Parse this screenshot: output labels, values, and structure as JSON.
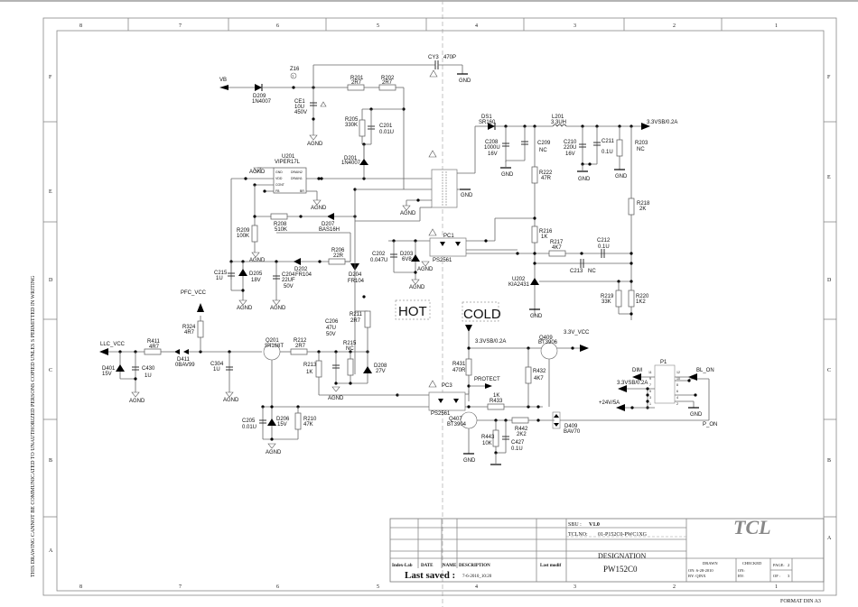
{
  "border": {
    "columns": [
      "8",
      "7",
      "6",
      "5",
      "4",
      "3",
      "2",
      "1"
    ],
    "rows": [
      "F",
      "E",
      "D",
      "C",
      "B",
      "A"
    ],
    "side_notice": "THIS DRAWING CANNOT BE COMMUNICATED TO UNAUTHORIZED PERSONS COPIED UNLES S PERMITTED IN WRITING",
    "format": "FORMAT DIN A3"
  },
  "zones": {
    "hot": "HOT",
    "cold": "COLD"
  },
  "nets": {
    "vb": "VB",
    "v33sb": "3.3VSB/0.2A",
    "v33sb_2": "3.3VSB/0.2A",
    "v33sb_3": "3.3VSB/0.2A",
    "v33_vcc": "3.3V_VCC",
    "pfc_vcc": "PFC_VCC",
    "llc_vcc": "LLC_VCC",
    "protect": "PROTECT",
    "dim": "DIM",
    "bl_on": "BL_ON",
    "v24": "+24V/5A",
    "p_on": "P_ON",
    "gnd": "GND",
    "agnd": "AGND"
  },
  "components": {
    "d209": {
      "ref": "D209",
      "value": "1N4007"
    },
    "z16": {
      "ref": "Z16",
      "value": "T"
    },
    "ce1": {
      "ref": "CE1",
      "value": "10U",
      "value2": "450V"
    },
    "r201": {
      "ref": "R201",
      "value": "2R7"
    },
    "r202": {
      "ref": "R202",
      "value": "2R7"
    },
    "cy3": {
      "ref": "CY3",
      "value": "470P"
    },
    "r205": {
      "ref": "R205",
      "value": "330K"
    },
    "c201": {
      "ref": "C201",
      "value": "0.01U"
    },
    "ds1": {
      "ref": "DS1",
      "value": "SR160"
    },
    "l201": {
      "ref": "L201",
      "value": "3.3UH"
    },
    "c208": {
      "ref": "C208",
      "value": "1000U",
      "value2": "16V"
    },
    "c209": {
      "ref": "C209",
      "value": "NC"
    },
    "c210": {
      "ref": "C210",
      "value": "220U",
      "value2": "16V"
    },
    "c211": {
      "ref": "C211",
      "value": "0.1U"
    },
    "r203": {
      "ref": "R203",
      "value": "NC"
    },
    "r222": {
      "ref": "R222",
      "value": "47R"
    },
    "r218": {
      "ref": "R218",
      "value": "2K"
    },
    "u201": {
      "ref": "U201",
      "value": "VIPER17L",
      "pins": [
        "GND",
        "VDD",
        "CONT",
        "FB",
        "DRAIN2",
        "DRAIN1",
        "BR"
      ]
    },
    "d201": {
      "ref": "D201",
      "value": "1N4007"
    },
    "r208": {
      "ref": "R208",
      "value": "510K"
    },
    "d207": {
      "ref": "D207",
      "value": "BAS16H"
    },
    "r209": {
      "ref": "R209",
      "value": "100K"
    },
    "r206": {
      "ref": "R206",
      "value": "22R"
    },
    "d202": {
      "ref": "D202",
      "value": "FR104"
    },
    "c215": {
      "ref": "C215",
      "value": "1U"
    },
    "d205": {
      "ref": "D205",
      "value": "18V"
    },
    "c204": {
      "ref": "C204",
      "value": "22UF",
      "value2": "50V"
    },
    "d204": {
      "ref": "D204",
      "value": "FR104"
    },
    "c202": {
      "ref": "C202",
      "value": "0.047U"
    },
    "d203": {
      "ref": "D203",
      "value": "6V8"
    },
    "pc1": {
      "ref": "PC1",
      "value": "PS2561"
    },
    "r216": {
      "ref": "R216",
      "value": "1K"
    },
    "r217": {
      "ref": "R217",
      "value": "4K7"
    },
    "c212": {
      "ref": "C212",
      "value": "0.1U"
    },
    "c213": {
      "ref": "C213",
      "value": "NC"
    },
    "u202": {
      "ref": "U202",
      "value": "KIA2431"
    },
    "r219": {
      "ref": "R219",
      "value": "33K"
    },
    "r220": {
      "ref": "R220",
      "value": "1K2"
    },
    "r324": {
      "ref": "R324",
      "value": "4R7"
    },
    "r411": {
      "ref": "R411",
      "value": "4R7"
    },
    "d411": {
      "ref": "D411",
      "value": "0BAV99"
    },
    "d401": {
      "ref": "D401",
      "value": "15V"
    },
    "c430": {
      "ref": "C430",
      "value": "1U"
    },
    "c304": {
      "ref": "C304",
      "value": "1U"
    },
    "q201": {
      "ref": "Q201",
      "value": "S4168T"
    },
    "r212": {
      "ref": "R212",
      "value": "2R7"
    },
    "r213": {
      "ref": "R213",
      "value": "1K"
    },
    "c206": {
      "ref": "C206",
      "value": "47U",
      "value2": "50V"
    },
    "r215": {
      "ref": "R215",
      "value": "NC"
    },
    "r211": {
      "ref": "R211",
      "value": "2R7"
    },
    "d208": {
      "ref": "D208",
      "value": "27V"
    },
    "c205": {
      "ref": "C205",
      "value": "0.01U"
    },
    "d206": {
      "ref": "D206",
      "value": "15V"
    },
    "r210": {
      "ref": "R210",
      "value": "47K"
    },
    "pc3": {
      "ref": "PC3",
      "value": "PS2561"
    },
    "r431": {
      "ref": "R431",
      "value": "470R"
    },
    "q409": {
      "ref": "Q409",
      "value": "BT3906"
    },
    "r432": {
      "ref": "R432",
      "value": "4K7"
    },
    "r433": {
      "ref": "R433",
      "value": "1K"
    },
    "q407": {
      "ref": "Q407",
      "value": "BT3904"
    },
    "r443": {
      "ref": "R443",
      "value": "10K"
    },
    "c427": {
      "ref": "C427",
      "value": "0.1U"
    },
    "r442": {
      "ref": "R442",
      "value": "2K2"
    },
    "d409": {
      "ref": "D409",
      "value": "BAV70"
    },
    "p1": {
      "ref": "P1",
      "pins": [
        "11",
        "12",
        "9",
        "10",
        "7",
        "8",
        "5",
        "6",
        "3",
        "4",
        "1",
        "2"
      ]
    }
  },
  "title_block": {
    "sbu_label": "SBU :",
    "sbu_value": "V1.0",
    "tclno_label": "TCLNO:",
    "tclno_value": "01-P152C0-PWC1XG",
    "designation_label": "DESIGNATION",
    "designation_value": "PW152C0",
    "headers": [
      "Index-Lab",
      "DATE",
      "NAME",
      "DESCRIPTION",
      "Last modif"
    ],
    "last_saved_label": "Last saved :",
    "last_saved_value": "7-6-2010_10:20",
    "drawn_label": "DRAWN",
    "drawn_on": "ON: 6-28-2010",
    "drawn_by": "BY: QINX",
    "checked_label": "CHECKED",
    "checked_on": "ON:",
    "checked_by": "BY:",
    "page_label": "PAGE:",
    "page_value": "2",
    "of_label": "OF :",
    "of_value": "3",
    "logo": "TCL"
  }
}
